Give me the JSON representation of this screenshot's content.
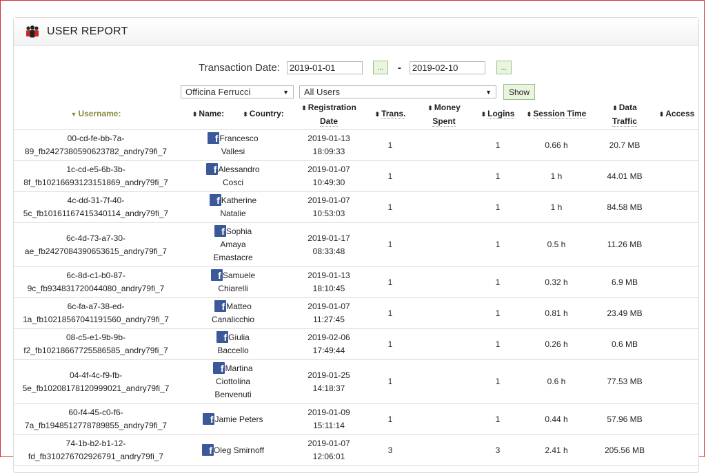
{
  "header": {
    "title": "USER REPORT"
  },
  "filters": {
    "date_label": "Transaction Date:",
    "date_from": "2019-01-01",
    "date_to": "2019-02-10",
    "picker_label": "...",
    "dash": "-",
    "location_select": "Officina Ferrucci",
    "users_select": "All Users",
    "show_label": "Show"
  },
  "columns": {
    "username": "Username:",
    "name": "Name:",
    "country": "Country:",
    "registration_date_1": "Registration",
    "registration_date_2": "Date",
    "trans": "Trans.",
    "money_1": "Money",
    "money_2": "Spent",
    "logins": "Logins",
    "session_time": "Session Time",
    "data_1": "Data",
    "data_2": "Traffic",
    "access": "Access"
  },
  "rows": [
    {
      "user1": "00-cd-fe-bb-7a-",
      "user2": "89_fb2427380590623782_andry79fi_7",
      "name": [
        "Francesco",
        "Vallesi"
      ],
      "date": "2019-01-13",
      "time": "18:09:33",
      "trans": "1",
      "logins": "1",
      "session": "0.66 h",
      "data": "20.7 MB"
    },
    {
      "user1": "1c-cd-e5-6b-3b-",
      "user2": "8f_fb10216693123151869_andry79fi_7",
      "name": [
        "Alessandro",
        "Cosci"
      ],
      "date": "2019-01-07",
      "time": "10:49:30",
      "trans": "1",
      "logins": "1",
      "session": "1 h",
      "data": "44.01 MB"
    },
    {
      "user1": "4c-dd-31-7f-40-",
      "user2": "5c_fb10161167415340114_andry79fi_7",
      "name": [
        "Katherine",
        "Natalie"
      ],
      "date": "2019-01-07",
      "time": "10:53:03",
      "trans": "1",
      "logins": "1",
      "session": "1 h",
      "data": "84.58 MB"
    },
    {
      "user1": "6c-4d-73-a7-30-",
      "user2": "ae_fb2427084390653615_andry79fi_7",
      "name": [
        "Sophia",
        "Amaya",
        "Emastacre"
      ],
      "date": "2019-01-17",
      "time": "08:33:48",
      "trans": "1",
      "logins": "1",
      "session": "0.5 h",
      "data": "11.26 MB"
    },
    {
      "user1": "6c-8d-c1-b0-87-",
      "user2": "9c_fb934831720044080_andry79fi_7",
      "name": [
        "Samuele",
        "Chiarelli"
      ],
      "date": "2019-01-13",
      "time": "18:10:45",
      "trans": "1",
      "logins": "1",
      "session": "0.32 h",
      "data": "6.9 MB"
    },
    {
      "user1": "6c-fa-a7-38-ed-",
      "user2": "1a_fb10218567041191560_andry79fi_7",
      "name": [
        "Matteo",
        "Canalicchio"
      ],
      "date": "2019-01-07",
      "time": "11:27:45",
      "trans": "1",
      "logins": "1",
      "session": "0.81 h",
      "data": "23.49 MB"
    },
    {
      "user1": "08-c5-e1-9b-9b-",
      "user2": "f2_fb10218667725586585_andry79fi_7",
      "name": [
        "Giulia",
        "Baccello"
      ],
      "date": "2019-02-06",
      "time": "17:49:44",
      "trans": "1",
      "logins": "1",
      "session": "0.26 h",
      "data": "0.6 MB"
    },
    {
      "user1": "04-4f-4c-f9-fb-",
      "user2": "5e_fb10208178120999021_andry79fi_7",
      "name": [
        "Martina",
        "Ciottolina",
        "Benvenuti"
      ],
      "date": "2019-01-25",
      "time": "14:18:37",
      "trans": "1",
      "logins": "1",
      "session": "0.6 h",
      "data": "77.53 MB"
    },
    {
      "user1": "60-f4-45-c0-f6-",
      "user2": "7a_fb1948512778789855_andry79fi_7",
      "name": [
        "Jamie Peters"
      ],
      "date": "2019-01-09",
      "time": "15:11:14",
      "trans": "1",
      "logins": "1",
      "session": "0.44 h",
      "data": "57.96 MB"
    },
    {
      "user1": "74-1b-b2-b1-12-",
      "user2": "fd_fb310276702926791_andry79fi_7",
      "name": [
        "Oleg Smirnoff"
      ],
      "date": "2019-01-07",
      "time": "12:06:01",
      "trans": "3",
      "logins": "3",
      "session": "2.41 h",
      "data": "205.56 MB"
    }
  ]
}
